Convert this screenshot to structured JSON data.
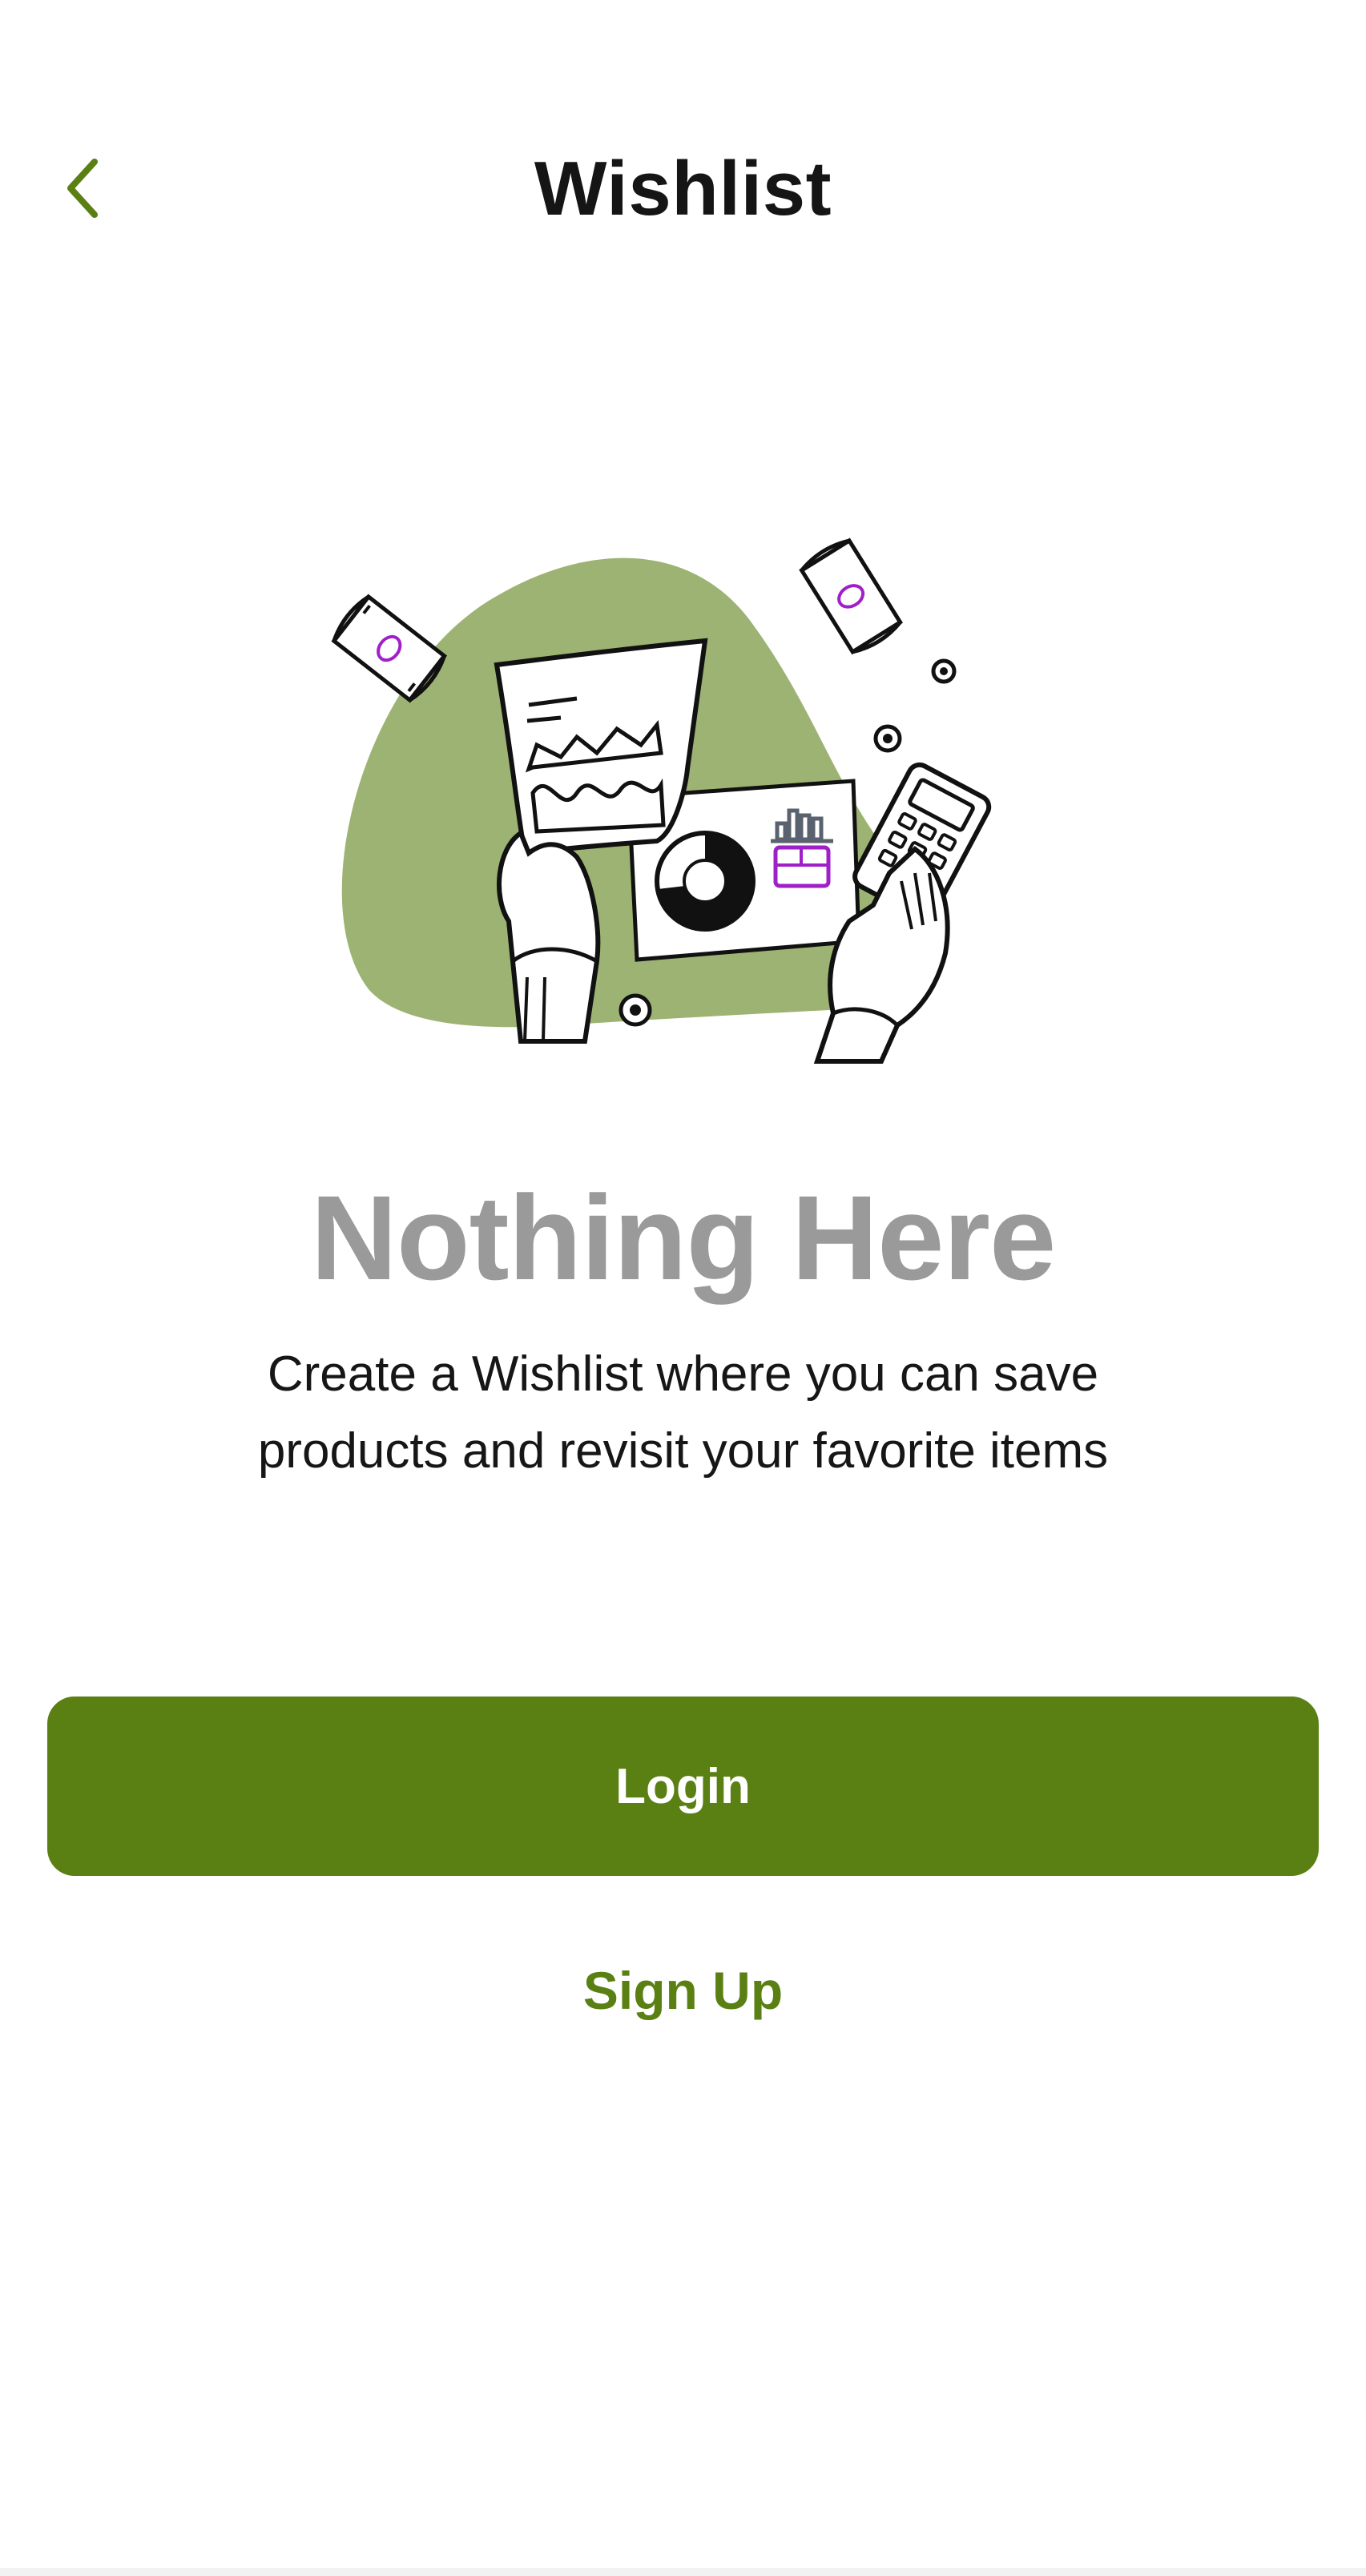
{
  "header": {
    "title": "Wishlist",
    "back_icon": "chevron-left-icon"
  },
  "empty_state": {
    "illustration": "finance-documents-illustration",
    "title": "Nothing Here",
    "subtitle": "Create a Wishlist where you can save products and revisit your favorite items"
  },
  "actions": {
    "login_label": "Login",
    "signup_label": "Sign Up"
  },
  "colors": {
    "accent": "#5a7f13",
    "blob": "#9db373",
    "title_gray": "#9a9a9a",
    "text": "#161616",
    "illustration_accent": "#a020c8"
  }
}
